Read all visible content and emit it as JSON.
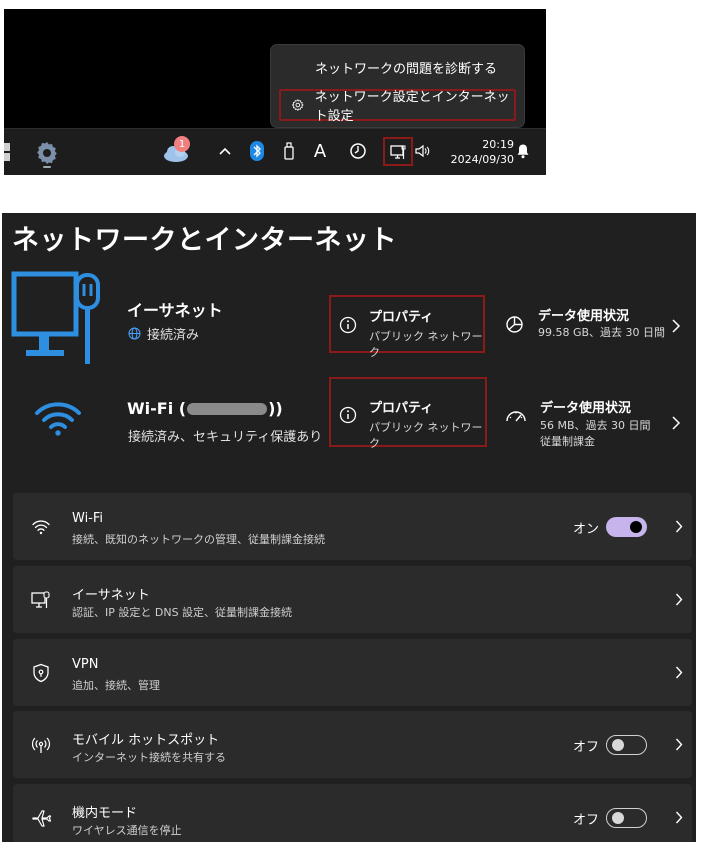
{
  "context_menu": {
    "item1_label": "ネットワークの問題を診断する",
    "item2_label": "ネットワーク設定とインターネット設定"
  },
  "taskbar": {
    "weather_badge": "1",
    "time": "20:19",
    "date": "2024/09/30",
    "ime_label": "A",
    "icons": [
      "start-icon",
      "settings-icon",
      "weather-icon",
      "chevron-up-icon",
      "bluetooth-icon",
      "usb-icon",
      "font-icon",
      "clock-icon",
      "network-icon",
      "volume-icon",
      "bell-icon"
    ]
  },
  "settings": {
    "title": "ネットワークとインターネット",
    "ethernet": {
      "name": "イーサネット",
      "status": "接続済み",
      "prop_title": "プロパティ",
      "prop_sub": "パブリック ネットワーク",
      "usage_title": "データ使用状況",
      "usage_sub": "99.58 GB、過去 30 日間"
    },
    "wifi": {
      "name": "Wi-Fi (",
      "name_end": "))",
      "status": "接続済み、セキュリティ保護あり",
      "prop_title": "プロパティ",
      "prop_sub": "パブリック ネットワーク",
      "usage_title": "データ使用状況",
      "usage_sub1": "56 MB、過去 30 日間",
      "usage_sub2": "従量制課金"
    },
    "cards": [
      {
        "title": "Wi-Fi",
        "desc": "接続、既知のネットワークの管理、従量制課金接続",
        "toggle": "オン",
        "on": true
      },
      {
        "title": "イーサネット",
        "desc": "認証、IP 設定と DNS 設定、従量制課金接続"
      },
      {
        "title": "VPN",
        "desc": "追加、接続、管理"
      },
      {
        "title": "モバイル ホットスポット",
        "desc": "インターネット接続を共有する",
        "toggle": "オフ",
        "on": false
      },
      {
        "title": "機内モード",
        "desc": "ワイヤレス通信を停止",
        "toggle": "オフ",
        "on": false
      }
    ]
  },
  "colors": {
    "highlight_box": "#8b1a1a",
    "accent_blue": "#1e88e5",
    "toggle_on": "#c7b4ec"
  }
}
